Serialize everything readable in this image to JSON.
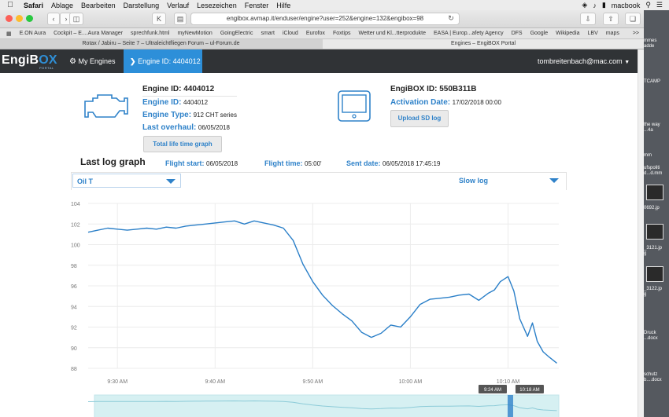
{
  "menubar": {
    "app": "Safari",
    "items": [
      "Ablage",
      "Bearbeiten",
      "Darstellung",
      "Verlauf",
      "Lesezeichen",
      "Fenster",
      "Hilfe"
    ],
    "computer_name": "macbook"
  },
  "browser": {
    "url": "engibox.avmap.it/enduser/engine?user=252&engine=132&engibox=98",
    "favorites": [
      "E.ON Aura",
      "Cockpit – E....Aura Manager",
      "sprechfunk.html",
      "myNewMotion",
      "GoingElectric",
      "smart",
      "iCloud",
      "Eurofox",
      "Foxtips",
      "Wetter und Kl...tterprodukte",
      "EASA | Europ...afety Agency",
      "DFS",
      "Google",
      "Wikipedia",
      "LBV",
      "maps"
    ],
    "more": ">>",
    "tabs": [
      {
        "label": "Rotax / Jabiru – Seite 7 – Ultraleichtfliegen Forum – ul-Forum.de",
        "active": false
      },
      {
        "label": "Engines – EngiBOX Portal",
        "active": true
      }
    ]
  },
  "nav": {
    "logo_main": "EngiB",
    "logo_box": "OX",
    "logo_sub": "PORTAL",
    "my_engines": "My Engines",
    "engine_tab": "Engine ID: 4404012",
    "user": "tombreitenbach@mac.com"
  },
  "engine": {
    "heading": "Engine ID: 4404012",
    "id_label": "Engine ID:",
    "id_value": "4404012",
    "type_label": "Engine Type:",
    "type_value": "912 CHT series",
    "overhaul_label": "Last overhaul:",
    "overhaul_value": "06/05/2018",
    "btn_total": "Total life time graph"
  },
  "engibox": {
    "heading": "EngiBOX ID: 550B311B",
    "activation_label": "Activation Date:",
    "activation_value": "17/02/2018 00:00",
    "btn_upload": "Upload SD log"
  },
  "log": {
    "title": "Last log graph",
    "flight_start_label": "Flight start:",
    "flight_start_value": "06/05/2018",
    "flight_time_label": "Flight time:",
    "flight_time_value": "05:00'",
    "sent_date_label": "Sent date:",
    "sent_date_value": "06/05/2018 17:45:19",
    "param_select": "Oil T",
    "log_select": "Slow log"
  },
  "chart_data": {
    "type": "line",
    "ylim": [
      88,
      104
    ],
    "yticks": [
      88,
      90,
      92,
      94,
      96,
      98,
      100,
      102,
      104
    ],
    "xticks": [
      "9:30 AM",
      "9:40 AM",
      "9:50 AM",
      "10:00 AM",
      "10:10 AM"
    ],
    "xtick_minutes": [
      15,
      25,
      35,
      45,
      55
    ],
    "xlim_minutes": [
      12.0,
      60.2
    ],
    "range_labels": [
      "9:24 AM",
      "10:18 AM"
    ],
    "series": [
      {
        "color": "#2a7fc8",
        "x": [
          12.0,
          13.0,
          14.0,
          15.0,
          16.0,
          17.0,
          18.0,
          19.0,
          20.0,
          21.0,
          22.0,
          23.0,
          24.0,
          25.0,
          26.0,
          27.0,
          28.0,
          29.0,
          30.0,
          31.0,
          32.0,
          33.0,
          34.0,
          35.0,
          36.0,
          37.0,
          38.0,
          39.0,
          40.0,
          41.0,
          42.0,
          43.0,
          44.0,
          45.0,
          46.0,
          47.0,
          48.0,
          49.0,
          50.0,
          51.0,
          52.0,
          53.0,
          53.6,
          54.2,
          55.0,
          55.6,
          56.2,
          57.0,
          57.5,
          58.0,
          58.6,
          59.2,
          60.0
        ],
        "y": [
          101.2,
          101.4,
          101.6,
          101.5,
          101.4,
          101.5,
          101.6,
          101.5,
          101.7,
          101.6,
          101.8,
          101.9,
          102.0,
          102.1,
          102.2,
          102.3,
          102.0,
          102.3,
          102.1,
          101.9,
          101.6,
          100.4,
          98.1,
          96.4,
          95.1,
          94.1,
          93.3,
          92.6,
          91.5,
          91.0,
          91.4,
          92.2,
          92.0,
          93.0,
          94.2,
          94.7,
          94.8,
          94.9,
          95.1,
          95.2,
          94.6,
          95.3,
          95.6,
          96.4,
          96.9,
          95.5,
          92.8,
          91.1,
          92.4,
          90.6,
          89.6,
          89.1,
          88.5
        ]
      }
    ]
  },
  "desktop": {
    "items": [
      "mmes\nadde",
      "TCAMP",
      "the way\n...4a",
      "mm",
      "ufspoliti\nd...d.mm",
      "0692.jp",
      "_3121.jp\ng",
      "_3122.jp\ng",
      "Druck\n...docx",
      "schutz\nb....docx"
    ]
  }
}
